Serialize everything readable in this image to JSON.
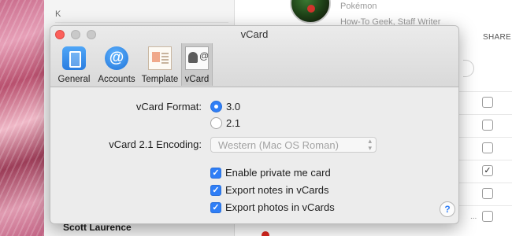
{
  "background": {
    "list_section_letter": "K",
    "contact_name_bottom": "Scott Laurence",
    "profile_line1": "Pokémon",
    "profile_line2": "How-To Geek, Staff Writer",
    "share_label": "SHARE",
    "row_checks": [
      "",
      "",
      "",
      "✓",
      "",
      "",
      "✓",
      ""
    ],
    "trailing_dots": "..."
  },
  "window": {
    "title": "vCard",
    "tabs": [
      {
        "label": "General",
        "icon": "general-switch-icon",
        "selected": false
      },
      {
        "label": "Accounts",
        "icon": "at-sign-icon",
        "selected": false
      },
      {
        "label": "Template",
        "icon": "template-card-icon",
        "selected": false
      },
      {
        "label": "vCard",
        "icon": "vcard-person-icon",
        "selected": true
      }
    ],
    "vcard_format": {
      "label": "vCard Format:",
      "options": [
        {
          "label": "3.0",
          "selected": true
        },
        {
          "label": "2.1",
          "selected": false
        }
      ]
    },
    "encoding": {
      "label": "vCard 2.1 Encoding:",
      "value": "Western (Mac OS Roman)",
      "enabled": false
    },
    "checkboxes": [
      {
        "label": "Enable private me card",
        "checked": true
      },
      {
        "label": "Export notes in vCards",
        "checked": true
      },
      {
        "label": "Export photos in vCards",
        "checked": true
      }
    ],
    "help_glyph": "?",
    "accent_color": "#2f7ef6"
  }
}
